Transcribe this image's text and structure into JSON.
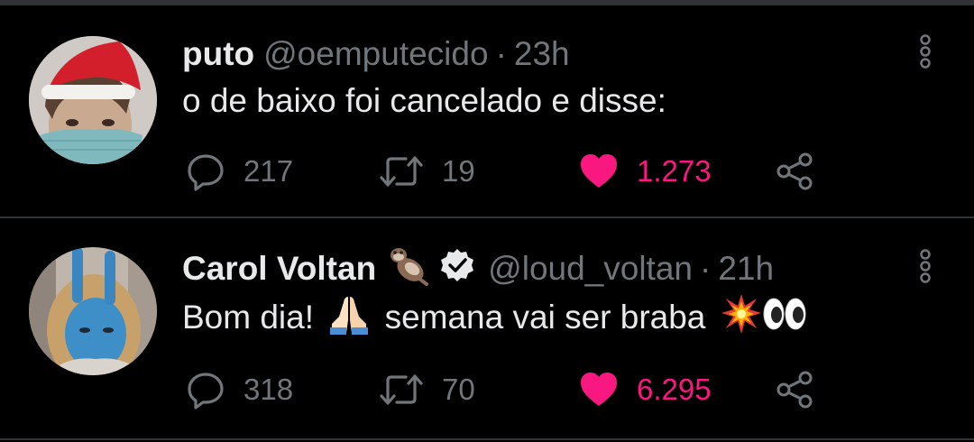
{
  "colors": {
    "background": "#000000",
    "divider": "#2f3336",
    "name": "#e7e9ea",
    "muted": "#71767b",
    "like": "#f91880"
  },
  "tweets": [
    {
      "name": "puto",
      "handle": "@oemputecido",
      "separator": "·",
      "time": "23h",
      "verified": false,
      "text": "o de baixo foi cancelado e disse:",
      "replies": "217",
      "retweets": "19",
      "likes": "1.273",
      "liked": true,
      "icons": [
        "reply-icon",
        "retweet-icon",
        "heart-icon",
        "share-icon",
        "more-icon"
      ]
    },
    {
      "name": "Carol Voltan",
      "handle": "@loud_voltan",
      "separator": "·",
      "time": "21h",
      "verified": true,
      "name_emoji": "🦦",
      "text_parts": [
        "Bom dia! ",
        " semana vai ser braba "
      ],
      "text_emojis": [
        "🙏",
        "💥",
        "👀"
      ],
      "replies": "318",
      "retweets": "70",
      "likes": "6.295",
      "liked": true,
      "icons": [
        "reply-icon",
        "retweet-icon",
        "heart-icon",
        "share-icon",
        "more-icon",
        "verified-badge-icon"
      ]
    }
  ]
}
